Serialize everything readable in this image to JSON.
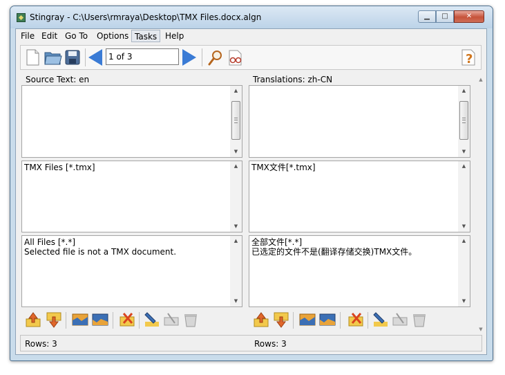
{
  "window": {
    "title": "Stingray - C:\\Users\\rmraya\\Desktop\\TMX Files.docx.algn"
  },
  "menu": [
    {
      "label": "File"
    },
    {
      "label": "Edit"
    },
    {
      "label": "Go To"
    },
    {
      "label": "Options"
    },
    {
      "label": "Tasks"
    },
    {
      "label": "Help"
    }
  ],
  "toolbar": {
    "page_indicator": "1 of 3",
    "icons": [
      "new-file-icon",
      "open-folder-icon",
      "save-icon",
      "previous-icon",
      "next-icon",
      "search-icon",
      "glasses-icon",
      "help-icon"
    ]
  },
  "source": {
    "header": "Source Text: en",
    "rows": [
      "",
      "TMX Files [*.tmx]",
      "All Files [*.*]\nSelected file is not a TMX document."
    ]
  },
  "target": {
    "header": "Translations: zh-CN",
    "rows": [
      "",
      "TMX文件[*.tmx]",
      "全部文件[*.*]\n已选定的文件不是(翻译存储交换)TMX文件。"
    ]
  },
  "row_actions": [
    "move-up-icon",
    "move-down-icon",
    "merge-up-icon",
    "merge-down-icon",
    "delete-icon",
    "edit-icon",
    "split-icon",
    "clear-icon"
  ],
  "status": {
    "source_rows": "Rows: 3",
    "target_rows": "Rows: 3"
  },
  "colors": {
    "title_bar": "#bcd3e8",
    "nav_arrow": "#3a7bd5",
    "close_button": "#c6523a"
  }
}
